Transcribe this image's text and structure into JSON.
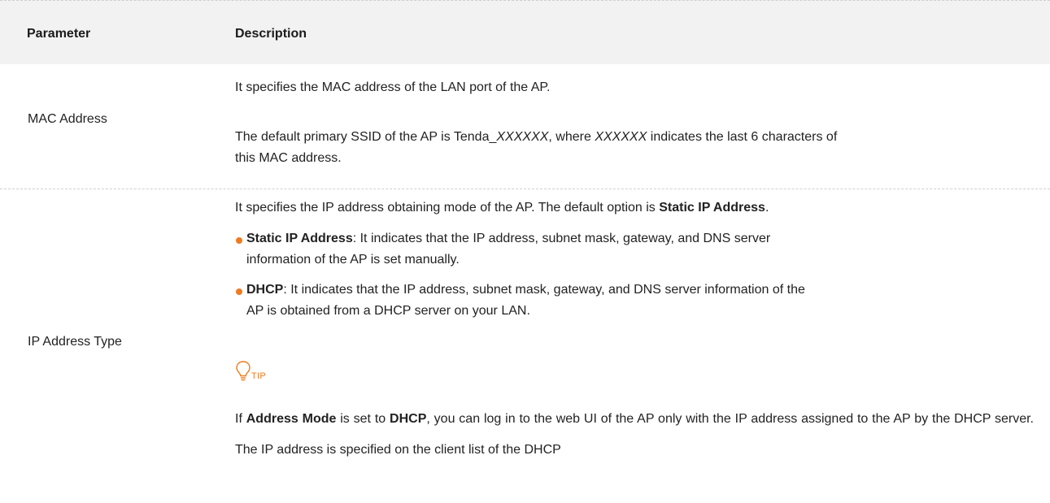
{
  "header": {
    "parameter": "Parameter",
    "description": "Description"
  },
  "rows": [
    {
      "parameter": "MAC Address",
      "lines": {
        "l1": "It specifies the MAC address of the LAN port of the AP.",
        "l2_a": "The default primary SSID of the AP is Tenda_",
        "l2_b": "XXXXXX",
        "l2_c": ", where ",
        "l2_d": "XXXXXX",
        "l2_e": " indicates the last 6 characters of",
        "l3": "this MAC address."
      }
    },
    {
      "parameter": "IP Address Type",
      "intro_a": "It specifies the IP address obtaining mode of the AP. The default option is ",
      "intro_b": "Static IP Address",
      "intro_c": ".",
      "bullets": [
        {
          "bold": "Static IP Address",
          "text_1": ": It indicates that the IP address, subnet mask, gateway, and DNS server",
          "text_2": "information of the AP is set manually."
        },
        {
          "bold": "DHCP",
          "text_1": ": It indicates that the IP address, subnet mask, gateway, and DNS server information of the",
          "text_2": "AP is obtained from a DHCP server on your LAN."
        }
      ],
      "tip": {
        "icon": "lightbulb-icon",
        "label": "TIP",
        "p_a": "If ",
        "p_b": "Address Mode",
        "p_c": " is set to ",
        "p_d": "DHCP",
        "p_e": ", you can log in to the web UI of the AP only with the IP address assigned to the AP by the DHCP server. The IP address is specified on the client list of the DHCP"
      }
    }
  ],
  "colors": {
    "accent": "#f07a1f",
    "header_bg": "#f2f2f2",
    "divider": "#cfcfcf"
  }
}
